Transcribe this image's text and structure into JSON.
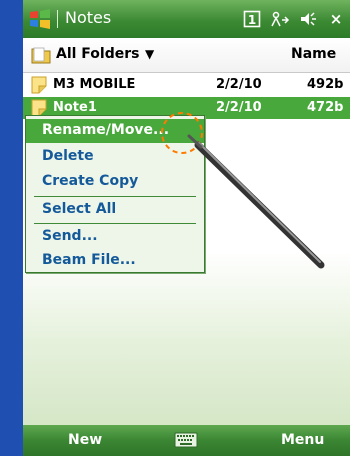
{
  "titlebar": {
    "title": "Notes",
    "icons": [
      "windows-start-icon",
      "notification-icon",
      "connectivity-icon",
      "volume-icon",
      "close-icon"
    ],
    "notification_glyph": "1",
    "close_glyph": "×"
  },
  "folder_bar": {
    "folder_label": "All Folders",
    "sort_label": "Name"
  },
  "list": {
    "rows": [
      {
        "name": "M3 MOBILE",
        "date": "2/2/10",
        "size": "492b"
      },
      {
        "name": "Note1",
        "date": "2/2/10",
        "size": "472b"
      }
    ]
  },
  "context_menu": {
    "items": [
      {
        "label": "Rename/Move..."
      },
      {
        "label": "Delete"
      },
      {
        "label": "Create Copy"
      },
      {
        "label": "Select All"
      },
      {
        "label": "Send..."
      },
      {
        "label": "Beam File..."
      }
    ]
  },
  "softkeys": {
    "left": "New",
    "right": "Menu"
  },
  "colors": {
    "accent_green": "#49a83c",
    "titlebar_green": "#3d8a34",
    "menu_text_blue": "#145a9a",
    "tap_indicator": "#ff7a00"
  }
}
